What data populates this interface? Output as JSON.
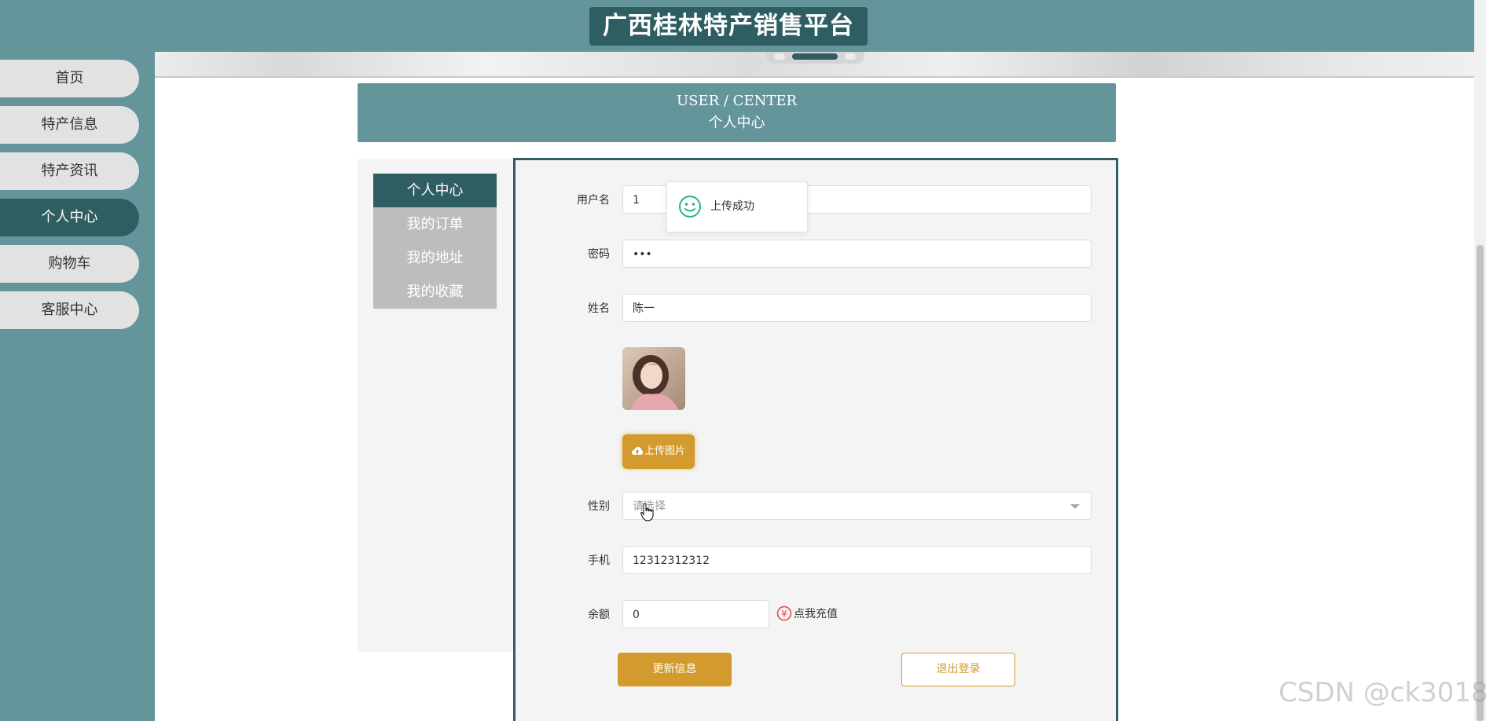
{
  "header": {
    "site_title": "广西桂林特产销售平台"
  },
  "sidebar": {
    "items": [
      {
        "label": "首页"
      },
      {
        "label": "特产信息"
      },
      {
        "label": "特产资讯"
      },
      {
        "label": "个人中心",
        "active": true
      },
      {
        "label": "购物车"
      },
      {
        "label": "客服中心"
      }
    ]
  },
  "page": {
    "title_en": "USER / CENTER",
    "title_cn": "个人中心"
  },
  "submenu": {
    "items": [
      {
        "label": "个人中心",
        "active": true
      },
      {
        "label": "我的订单"
      },
      {
        "label": "我的地址"
      },
      {
        "label": "我的收藏"
      }
    ]
  },
  "form": {
    "username": {
      "label": "用户名",
      "value": "1"
    },
    "password": {
      "label": "密码",
      "value": "•••"
    },
    "name": {
      "label": "姓名",
      "value": "陈一"
    },
    "upload_label": "上传图片",
    "gender": {
      "label": "性别",
      "placeholder": "请选择"
    },
    "phone": {
      "label": "手机",
      "value": "12312312312"
    },
    "balance": {
      "label": "余额",
      "value": "0"
    },
    "recharge_label": "点我充值",
    "update_label": "更新信息",
    "logout_label": "退出登录"
  },
  "toast": {
    "message": "上传成功"
  },
  "watermark": "CSDN @ck3018",
  "colors": {
    "primary_dark": "#2f5e62",
    "primary": "#64959b",
    "accent": "#d39b2d",
    "success": "#2bb47a"
  }
}
